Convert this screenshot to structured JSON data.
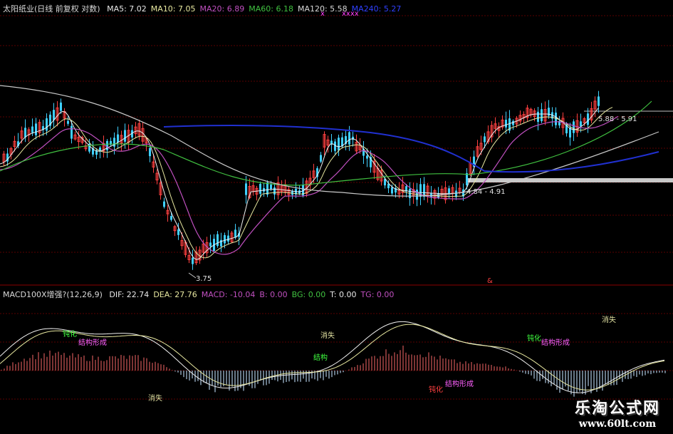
{
  "price_panel": {
    "title": "太阳纸业(日线 前复权 对数)",
    "ma": [
      {
        "label": "MA5:",
        "value": "7.02",
        "color": "#e8e8e8"
      },
      {
        "label": "MA10:",
        "value": "7.05",
        "color": "#e8e8a0"
      },
      {
        "label": "MA20:",
        "value": "6.89",
        "color": "#c050c0"
      },
      {
        "label": "MA60:",
        "value": "6.18",
        "color": "#40c040"
      },
      {
        "label": "MA120:",
        "value": "5.58",
        "color": "#d8d8d8"
      },
      {
        "label": "MA240:",
        "value": "5.27",
        "color": "#3040ff"
      }
    ],
    "annotations": [
      "3.75",
      "5.88 - 5.91",
      "4.84 - 4.91"
    ]
  },
  "macd_panel": {
    "title": "MACD100X增强?(12,26,9)",
    "items": [
      {
        "label": "DIF:",
        "value": "22.74",
        "color": "#e8e8e8"
      },
      {
        "label": "DEA:",
        "value": "27.76",
        "color": "#e8e8a0"
      },
      {
        "label": "MACD:",
        "value": "-10.04",
        "color": "#c050c0"
      },
      {
        "label": "B:",
        "value": "0.00",
        "color": "#c050c0"
      },
      {
        "label": "BG:",
        "value": "0.00",
        "color": "#40c040"
      },
      {
        "label": "T:",
        "value": "0.00",
        "color": "#e8e8e8"
      },
      {
        "label": "TG:",
        "value": "0.00",
        "color": "#c050c0"
      }
    ],
    "signals": [
      "钝化",
      "结构形成",
      "消失",
      "结构",
      "消失",
      "钝化",
      "结构形成",
      "钝化",
      "结构形成",
      "消失"
    ]
  },
  "watermark": {
    "title": "乐淘公式网",
    "url": "www.60lt.com"
  },
  "chart_data": {
    "type": "line",
    "price_scale": "log",
    "price_low_label": "3.75",
    "series": [
      {
        "name": "MA5",
        "values": [
          7.02
        ]
      },
      {
        "name": "MA10",
        "values": [
          7.05
        ]
      },
      {
        "name": "MA20",
        "values": [
          6.89
        ]
      },
      {
        "name": "MA60",
        "values": [
          6.18
        ]
      },
      {
        "name": "MA120",
        "values": [
          5.58
        ]
      },
      {
        "name": "MA240",
        "values": [
          5.27
        ]
      }
    ],
    "macd": {
      "DIF": 22.74,
      "DEA": 27.76,
      "MACD": -10.04,
      "B": 0.0,
      "BG": 0.0,
      "T": 0.0,
      "TG": 0.0
    }
  }
}
